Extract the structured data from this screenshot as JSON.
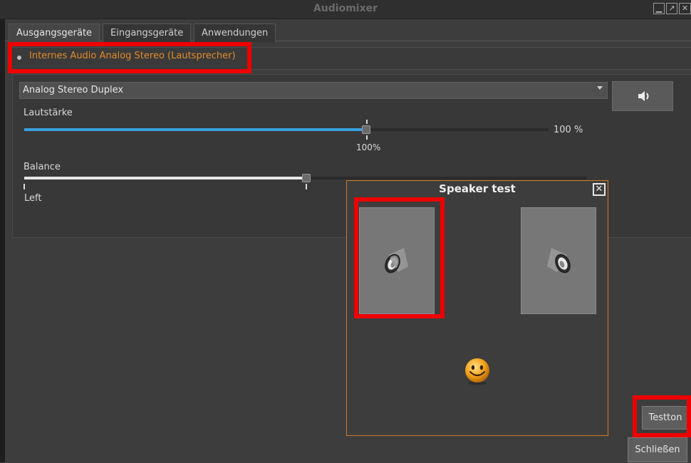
{
  "window": {
    "title": "Audiomixer",
    "controls": [
      "minimize-icon",
      "maximize-icon",
      "close-icon"
    ]
  },
  "tabs": [
    {
      "label": "Ausgangsgeräte",
      "active": true
    },
    {
      "label": "Eingangsgeräte",
      "active": false
    },
    {
      "label": "Anwendungen",
      "active": false
    }
  ],
  "device": {
    "name": "Internes Audio Analog Stereo (Lautsprecher)",
    "profile": "Analog Stereo Duplex",
    "mute_icon": "speaker-volume-icon",
    "volume": {
      "label": "Lautstärke",
      "value_text": "100 %",
      "mark_text": "100%",
      "level_fraction": 0.65
    },
    "balance": {
      "label": "Balance",
      "left_text": "Left",
      "level_fraction": 0.5
    }
  },
  "speaker_test": {
    "title": "Speaker test",
    "close_icon": "close-icon",
    "speakers": [
      "speaker-left",
      "speaker-right"
    ],
    "listener_icon": "smiley-icon"
  },
  "buttons": {
    "test": "Testton",
    "close": "Schließen"
  },
  "colors": {
    "accent_orange": "#e38a2b",
    "volume_blue": "#3aa0e0",
    "highlight_red": "#ee0000"
  }
}
